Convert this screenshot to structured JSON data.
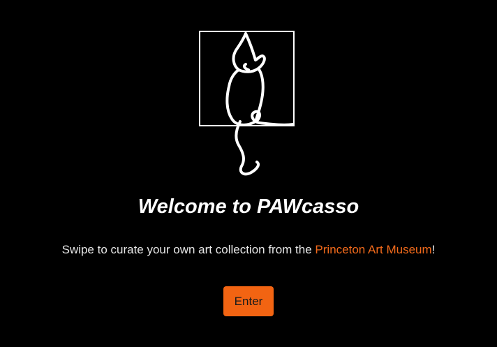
{
  "hero": {
    "logo_icon": "cat-line-drawing-icon",
    "title": "Welcome to PAWcasso"
  },
  "tagline": {
    "prefix": "Swipe to curate your own art collection from the ",
    "link": "Princeton Art Museum",
    "suffix": "!"
  },
  "actions": {
    "enter_label": "Enter"
  },
  "colors": {
    "background": "#000000",
    "accent": "#f26412",
    "text": "#ffffff"
  }
}
